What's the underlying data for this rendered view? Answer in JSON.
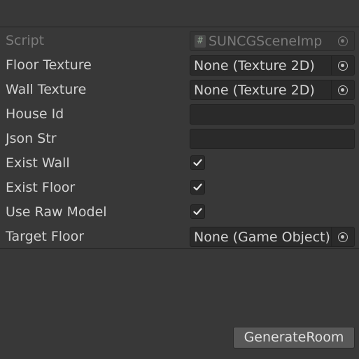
{
  "inspector": {
    "rows": [
      {
        "label": "Script",
        "value": "SUNCGSceneImp",
        "icon": "hash-script-icon"
      },
      {
        "label": "Floor Texture",
        "value": "None (Texture 2D)"
      },
      {
        "label": "Wall Texture",
        "value": "None (Texture 2D)"
      },
      {
        "label": "House Id",
        "value": ""
      },
      {
        "label": "Json Str",
        "value": ""
      },
      {
        "label": "Exist Wall",
        "checked": true
      },
      {
        "label": "Exist Floor",
        "checked": true
      },
      {
        "label": "Use Raw Model",
        "checked": true
      },
      {
        "label": "Target Floor",
        "value": "None (Game Object)"
      }
    ],
    "script_icon_glyph": "#"
  },
  "actions": {
    "generate_label": "GenerateRoom"
  },
  "colors": {
    "background": "#383838",
    "field": "#2a2a2a",
    "button": "#585858",
    "text": "#d2d2d2"
  }
}
